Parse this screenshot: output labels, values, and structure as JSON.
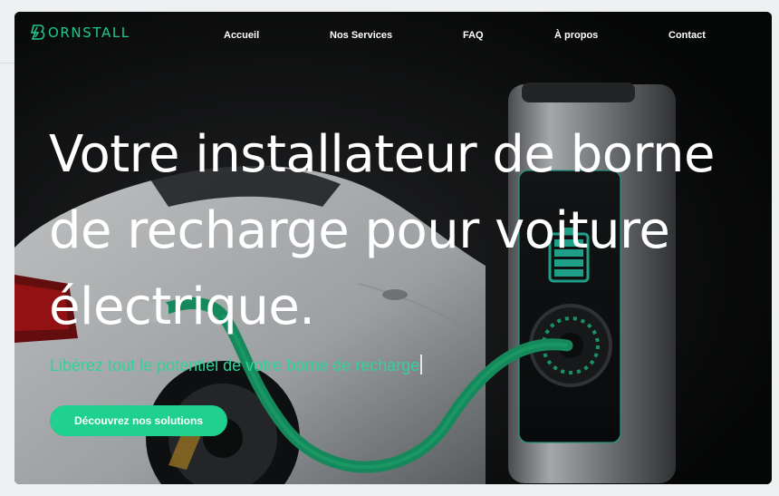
{
  "brand": {
    "logo_text": "ORNSTALL",
    "accent": "#1fd08f"
  },
  "nav": {
    "items": [
      {
        "label": "Accueil"
      },
      {
        "label": "Nos Services"
      },
      {
        "label": "FAQ"
      },
      {
        "label": "À propos"
      },
      {
        "label": "Contact"
      }
    ]
  },
  "hero": {
    "headline_line1": "Votre installateur de borne",
    "headline_line2": "de recharge pour voiture",
    "headline_line3": "électrique.",
    "tagline": "Libérez tout le potentiel de votre borne de recharge",
    "cta_label": "Découvrez nos solutions",
    "image": {
      "subject": "white-electric-car-charging-at-station",
      "cable_color": "#1aa870",
      "screen_color": "#28c2a6"
    }
  }
}
